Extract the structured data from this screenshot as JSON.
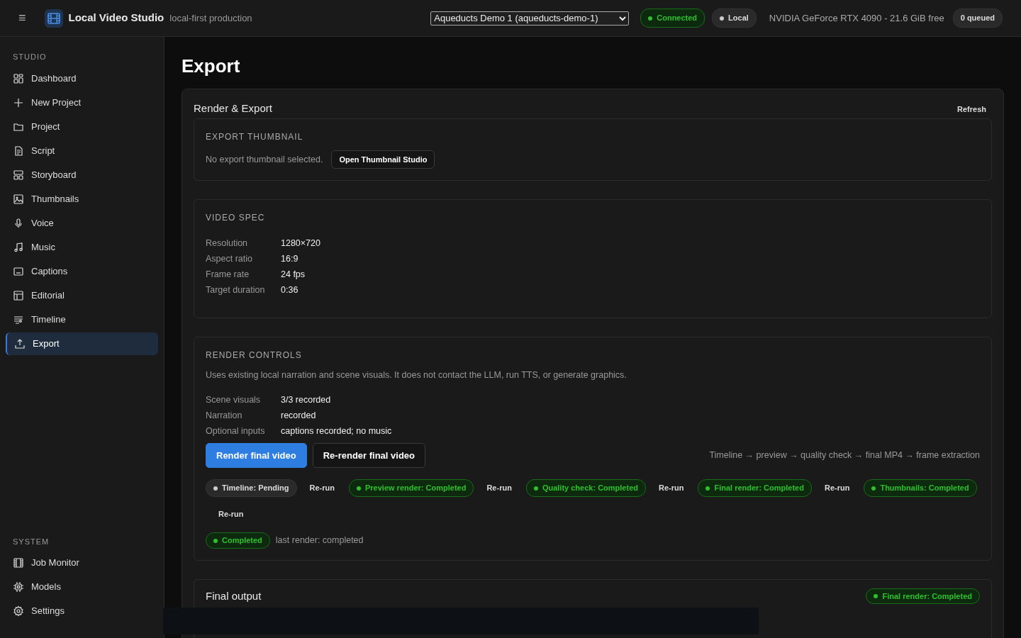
{
  "topbar": {
    "menu_glyph": "≡",
    "app_name": "Local Video Studio",
    "tagline": "local-first production",
    "project_select": {
      "value": "Aqueducts Demo 1 (aqueducts-demo-1)"
    },
    "badges": [
      {
        "text": "Connected",
        "active": true
      },
      {
        "text": "Local",
        "active": false
      }
    ],
    "gpu": "NVIDIA GeForce RTX 4090 - 21.6 GiB free",
    "queue": "0 queued"
  },
  "sidebar": {
    "sections": [
      {
        "heading": "STUDIO",
        "items": [
          {
            "label": "Dashboard",
            "selected": false
          },
          {
            "label": "New Project",
            "selected": false
          },
          {
            "label": "Project",
            "selected": false
          },
          {
            "label": "Script",
            "selected": false
          },
          {
            "label": "Storyboard",
            "selected": false
          },
          {
            "label": "Thumbnails",
            "selected": false
          },
          {
            "label": "Voice",
            "selected": false
          },
          {
            "label": "Music",
            "selected": false
          },
          {
            "label": "Captions",
            "selected": false
          },
          {
            "label": "Editorial",
            "selected": false
          },
          {
            "label": "Timeline",
            "selected": false
          },
          {
            "label": "Export",
            "selected": true
          }
        ]
      },
      {
        "heading": "SYSTEM",
        "items": [
          {
            "label": "Job Monitor",
            "selected": false
          },
          {
            "label": "Models",
            "selected": false
          },
          {
            "label": "Settings",
            "selected": false
          }
        ]
      }
    ]
  },
  "page_title": "Export",
  "panel": {
    "title": "Render & Export",
    "refresh": "Refresh",
    "thumbnail": {
      "heading": "EXPORT THUMBNAIL",
      "message": "No export thumbnail selected.",
      "button": "Open Thumbnail Studio"
    },
    "video_spec": {
      "heading": "VIDEO SPEC",
      "rows": [
        {
          "label": "Resolution",
          "value": "1280×720"
        },
        {
          "label": "Aspect ratio",
          "value": "16:9"
        },
        {
          "label": "Frame rate",
          "value": "24 fps"
        },
        {
          "label": "Target duration",
          "value": "0:36"
        }
      ]
    },
    "render_controls": {
      "heading": "RENDER CONTROLS",
      "description": "Uses existing local narration and scene visuals. It does not contact the LLM, run TTS, or generate graphics.",
      "rows": [
        {
          "label": "Scene visuals",
          "value": "3/3 recorded"
        },
        {
          "label": "Narration",
          "value": "recorded"
        },
        {
          "label": "Optional inputs",
          "value": "captions recorded; no music"
        }
      ],
      "primary_button": "Render final video",
      "secondary_button": "Re-render final video",
      "pipeline": "Timeline → preview → quality check → final MP4 → frame extraction",
      "stages": [
        {
          "text": "Timeline: Pending",
          "active": false,
          "rerun": "Re-run"
        },
        {
          "text": "Preview render: Completed",
          "active": true,
          "rerun": "Re-run"
        },
        {
          "text": "Quality check: Completed",
          "active": true,
          "rerun": "Re-run"
        },
        {
          "text": "Final render: Completed",
          "active": true,
          "rerun": "Re-run"
        },
        {
          "text": "Thumbnails: Completed",
          "active": true,
          "rerun": "Re-run"
        }
      ],
      "overall": {
        "text": "Completed",
        "active": true,
        "note": "last render: completed"
      }
    },
    "final_output": {
      "title": "Final output",
      "badge": {
        "text": "Final render: Completed",
        "active": true
      }
    }
  }
}
